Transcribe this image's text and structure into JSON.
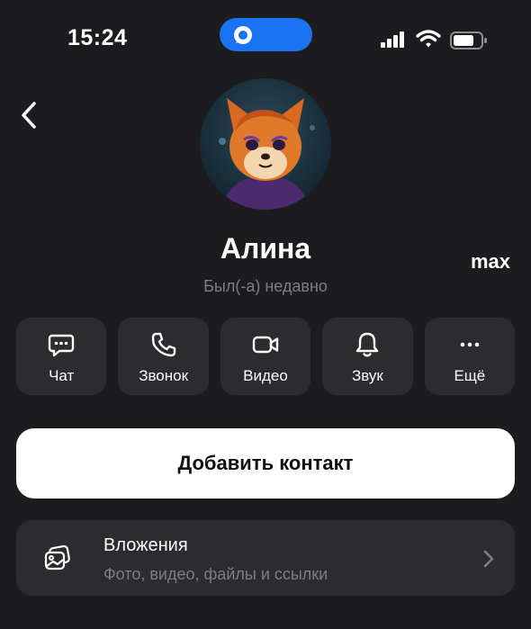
{
  "status_bar": {
    "time": "15:24",
    "app_name": "max"
  },
  "profile": {
    "name": "Алина",
    "status": "Был(-а) недавно"
  },
  "actions": [
    {
      "label": "Чат",
      "icon": "chat-icon"
    },
    {
      "label": "Звонок",
      "icon": "phone-icon"
    },
    {
      "label": "Видео",
      "icon": "video-icon"
    },
    {
      "label": "Звук",
      "icon": "bell-icon"
    },
    {
      "label": "Ещё",
      "icon": "more-icon"
    }
  ],
  "add_contact_label": "Добавить контакт",
  "attachments": {
    "title": "Вложения",
    "subtitle": "Фото, видео, файлы и ссылки"
  },
  "colors": {
    "background": "#1c1c1e",
    "tile": "#2c2c2e",
    "accent": "#1a73f2",
    "muted_text": "#7d7d82"
  }
}
